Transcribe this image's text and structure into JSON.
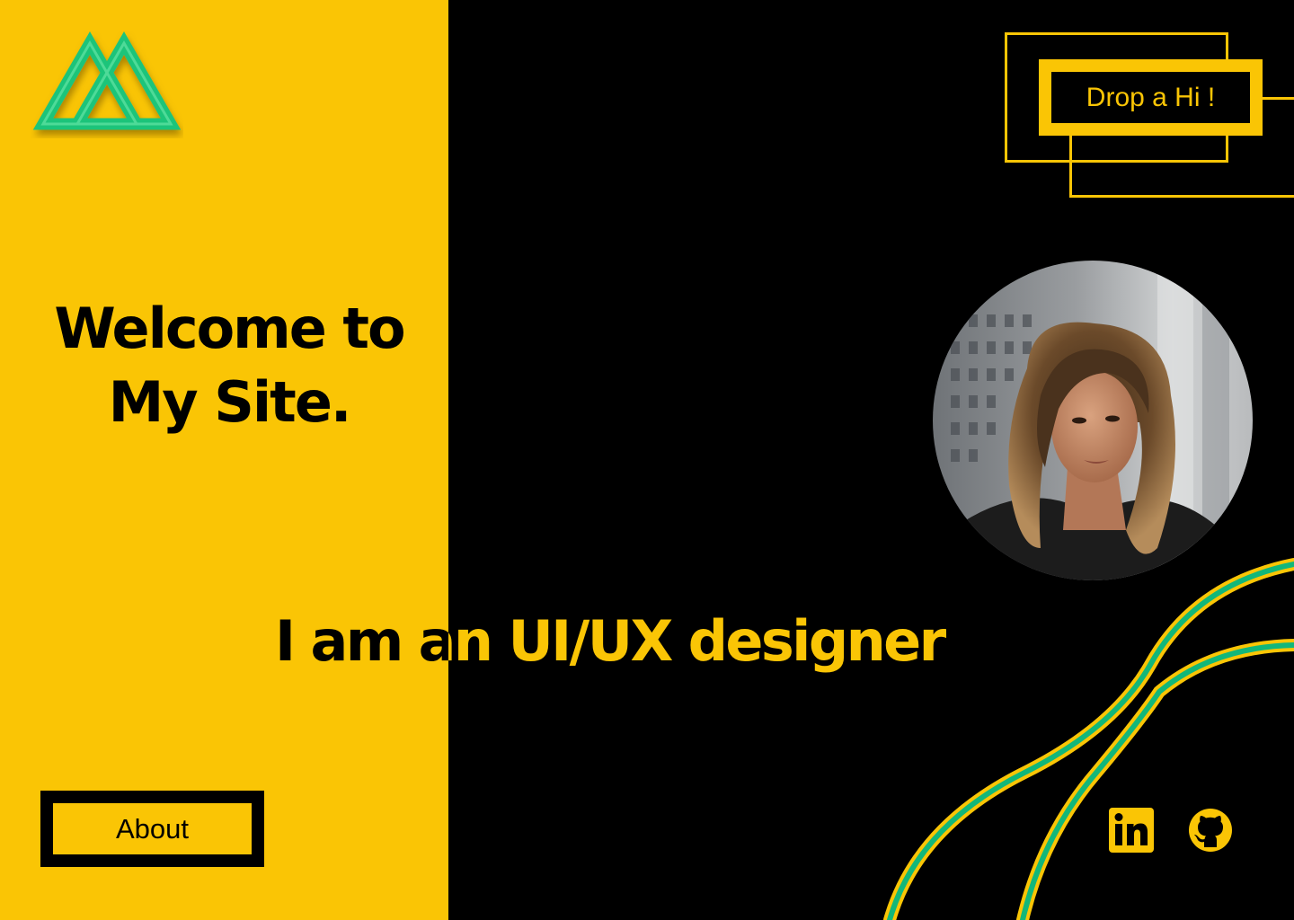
{
  "colors": {
    "accent": "#FAC505",
    "background": "#000000",
    "logo_green": "#1FC47A",
    "wave_green": "#12B77A"
  },
  "hero": {
    "welcome_line1": "Welcome to",
    "welcome_line2": "My Site.",
    "tagline": "I am an UI/UX designer"
  },
  "nav": {
    "about_label": "About",
    "contact_label": "Drop a Hi !"
  },
  "social": {
    "linkedin_icon": "linkedin-icon",
    "github_icon": "github-icon"
  },
  "logo": {
    "icon": "double-triangle-logo"
  }
}
